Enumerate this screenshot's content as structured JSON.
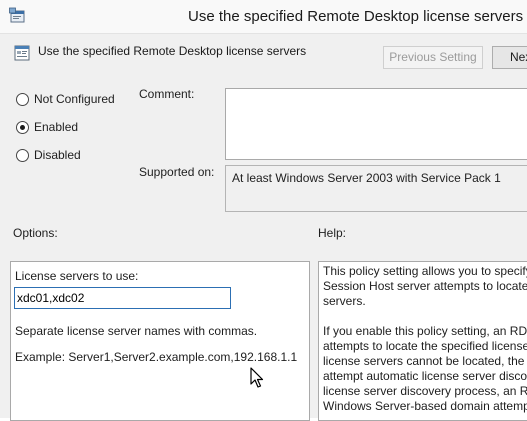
{
  "window": {
    "title": "Use the specified Remote Desktop license servers"
  },
  "header": {
    "title": "Use the specified Remote Desktop license servers",
    "previous_setting_label": "Previous Setting",
    "next_setting_label": "Nex"
  },
  "state": {
    "options": [
      "Not Configured",
      "Enabled",
      "Disabled"
    ],
    "selected": "Enabled"
  },
  "comment": {
    "label": "Comment:",
    "value": ""
  },
  "supported_on": {
    "label": "Supported on:",
    "value": "At least Windows Server 2003 with Service Pack 1"
  },
  "options_pane": {
    "label": "Options:",
    "servers_label": "License servers to use:",
    "servers_value": "xdc01,xdc02",
    "hint": "Separate license server names with commas.",
    "example": "Example: Server1,Server2.example.com,192.168.1.1"
  },
  "help_pane": {
    "label": "Help:",
    "paragraph1": [
      "This policy setting allows you to specify",
      "Session Host server attempts to locate l",
      "servers."
    ],
    "paragraph2": [
      "If you enable this policy setting, an RD",
      "attempts to locate the specified license",
      "license servers cannot be located, the R",
      "attempt automatic license server disco",
      "license server discovery process, an RD",
      "Windows Server-based domain attemp"
    ]
  },
  "icons": {
    "app": "policy-window-icon",
    "header": "policy-setting-icon",
    "cursor": "mouse-pointer-icon"
  },
  "colors": {
    "content_bg": "#f0f0f0",
    "input_focus_border": "#2c6fb3"
  }
}
